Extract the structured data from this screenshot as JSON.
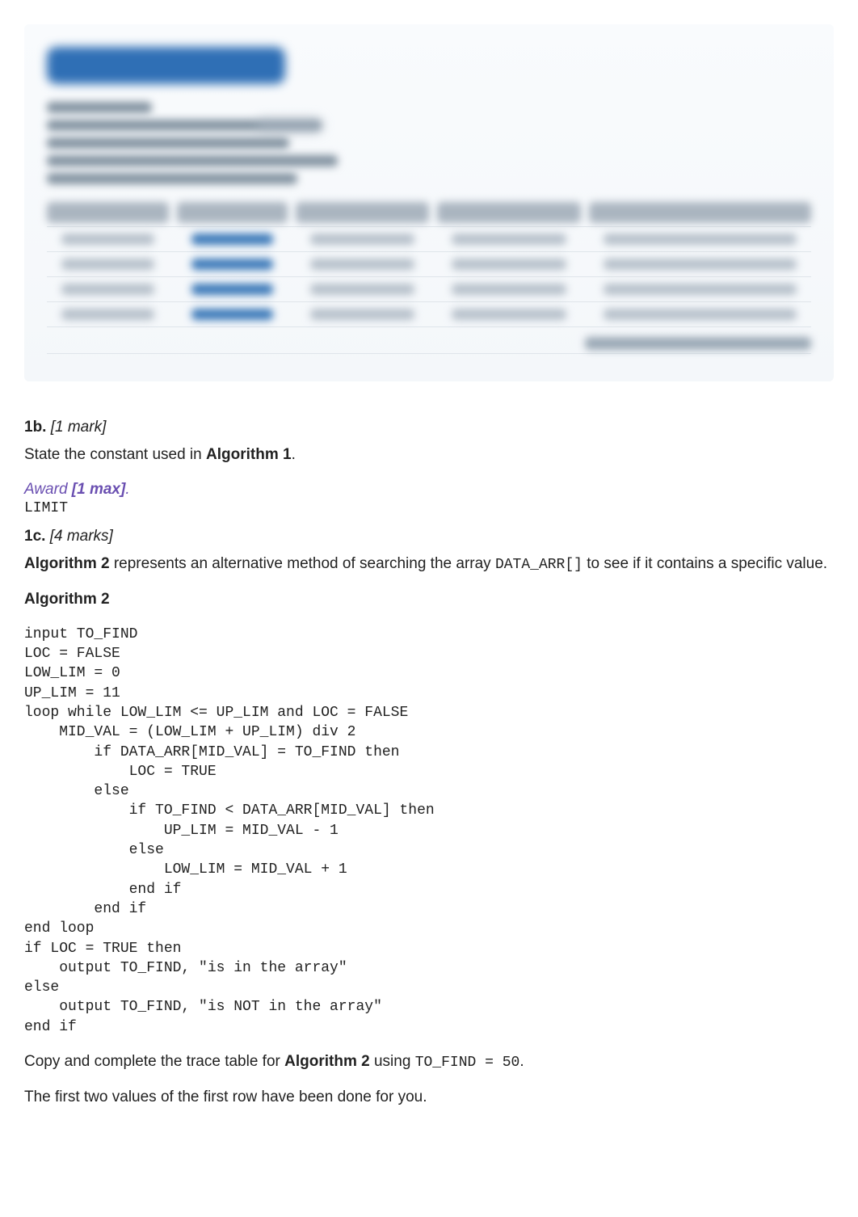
{
  "q1b": {
    "number": "1b.",
    "marks": "[1 mark]",
    "prompt_pre": "State the constant used in ",
    "algo_ref": "Algorithm 1",
    "prompt_post": "."
  },
  "award": {
    "label": "Award ",
    "max": "[1 max]",
    "post": "."
  },
  "limit_text": "LIMIT",
  "q1c": {
    "number": "1c.",
    "marks": "[4 marks]"
  },
  "alg2_desc": {
    "algo_ref": "Algorithm 2",
    "mid": " represents an alternative method of searching the array ",
    "code": "DATA_ARR[]",
    "tail": " to see if it contains a specific value."
  },
  "alg2_heading": "Algorithm 2",
  "algorithm2_code": "input TO_FIND\nLOC = FALSE\nLOW_LIM = 0\nUP_LIM = 11\nloop while LOW_LIM <= UP_LIM and LOC = FALSE\n    MID_VAL = (LOW_LIM + UP_LIM) div 2\n        if DATA_ARR[MID_VAL] = TO_FIND then\n            LOC = TRUE\n        else\n            if TO_FIND < DATA_ARR[MID_VAL] then\n                UP_LIM = MID_VAL - 1\n            else\n                LOW_LIM = MID_VAL + 1\n            end if\n        end if\nend loop\nif LOC = TRUE then\n    output TO_FIND, \"is in the array\"\nelse\n    output TO_FIND, \"is NOT in the array\"\nend if",
  "trace_instr": {
    "pre": "Copy and complete the trace table for ",
    "algo_ref": "Algorithm 2",
    "mid": " using ",
    "code": "TO_FIND = 50",
    "post": "."
  },
  "first_row_note": "The first two values of the first row have been done for you."
}
